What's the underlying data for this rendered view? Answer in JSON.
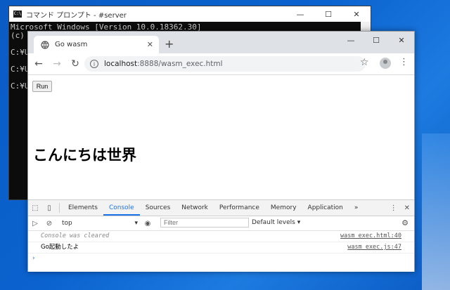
{
  "cmd": {
    "title": "コマンド プロンプト - #server",
    "lines": [
      "Microsoft Windows [Version 10.0.18362.30]",
      "(c)",
      "",
      "C:¥U",
      "",
      "C:¥U",
      "",
      "C:¥U"
    ]
  },
  "browser": {
    "tab_title": "Go wasm",
    "url_host": "localhost",
    "url_path": ":8888/wasm_exec.html"
  },
  "page": {
    "run_label": "Run",
    "heading": "こんにちは世界"
  },
  "devtools": {
    "tabs": [
      "Elements",
      "Console",
      "Sources",
      "Network",
      "Performance",
      "Memory",
      "Application"
    ],
    "more": "»",
    "context": "top",
    "filter_placeholder": "Filter",
    "levels": "Default levels ▾",
    "logs": [
      {
        "text": "Console was cleared",
        "src": "wasm_exec.html:40"
      },
      {
        "text": "Go起動したよ",
        "src": "wasm_exec.js:47"
      }
    ],
    "prompt": "›"
  },
  "icons": [
    "globe-icon",
    "close-icon",
    "plus-icon",
    "back-icon",
    "forward-icon",
    "reload-icon",
    "info-icon",
    "star-icon",
    "avatar-icon",
    "kebab-icon",
    "inspect-icon",
    "device-icon",
    "clear-console-icon",
    "eye-icon",
    "gear-icon",
    "minimize-icon",
    "maximize-icon"
  ]
}
